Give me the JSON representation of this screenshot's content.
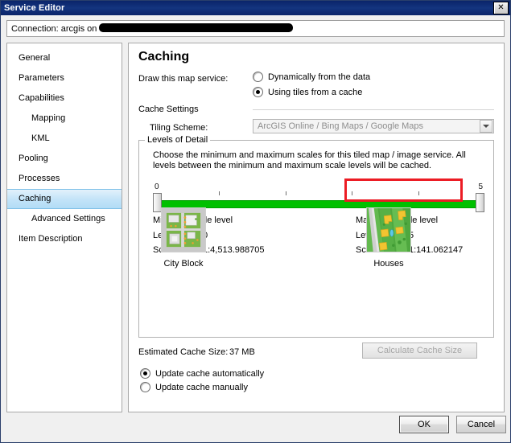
{
  "window": {
    "title": "Service Editor",
    "close_label": "✕"
  },
  "connection": {
    "label": "Connection: arcgis on",
    "value_redacted": ""
  },
  "sidebar": {
    "items": [
      {
        "label": "General",
        "indent": false,
        "selected": false
      },
      {
        "label": "Parameters",
        "indent": false,
        "selected": false
      },
      {
        "label": "Capabilities",
        "indent": false,
        "selected": false
      },
      {
        "label": "Mapping",
        "indent": true,
        "selected": false
      },
      {
        "label": "KML",
        "indent": true,
        "selected": false
      },
      {
        "label": "Pooling",
        "indent": false,
        "selected": false
      },
      {
        "label": "Processes",
        "indent": false,
        "selected": false
      },
      {
        "label": "Caching",
        "indent": false,
        "selected": true
      },
      {
        "label": "Advanced Settings",
        "indent": true,
        "selected": false
      },
      {
        "label": "Item Description",
        "indent": false,
        "selected": false
      }
    ]
  },
  "content": {
    "title": "Caching",
    "draw_label": "Draw this map service:",
    "draw_options": [
      {
        "label": "Dynamically from the data",
        "checked": false
      },
      {
        "label": "Using tiles from a cache",
        "checked": true
      }
    ],
    "cache_settings_heading": "Cache Settings",
    "tiling_scheme_label": "Tiling Scheme:",
    "tiling_scheme_value": "ArcGIS Online / Bing Maps / Google Maps",
    "levels_of_detail": {
      "legend": "Levels of Detail",
      "description": "Choose the minimum and maximum scales for this tiled map / image service. All levels between the minimum and maximum scale levels will be cached.",
      "slider": {
        "min_end_label": "0",
        "max_end_label": "5",
        "tick_count": 4
      },
      "minimum": {
        "heading": "Minimum scale level",
        "level_label": "Level:",
        "level_value": "0",
        "scale_label": "Scale:",
        "scale_value": "1:4,513.988705"
      },
      "maximum": {
        "heading": "Maximum scale level",
        "level_label": "Level:",
        "level_value": "5",
        "scale_label": "Scale:",
        "scale_value": "1:141.062147"
      },
      "thumbnails": [
        {
          "caption": "City Block",
          "name": "city-block-preview"
        },
        {
          "caption": "Houses",
          "name": "houses-preview"
        }
      ],
      "highlight_color": "#ec1c24"
    },
    "estimated_cache_size_label": "Estimated Cache Size:",
    "estimated_cache_size_value": "37 MB",
    "calculate_button": "Calculate Cache Size",
    "update_options": [
      {
        "label": "Update cache automatically",
        "checked": true
      },
      {
        "label": "Update cache manually",
        "checked": false
      }
    ]
  },
  "footer": {
    "ok": "OK",
    "cancel": "Cancel"
  }
}
